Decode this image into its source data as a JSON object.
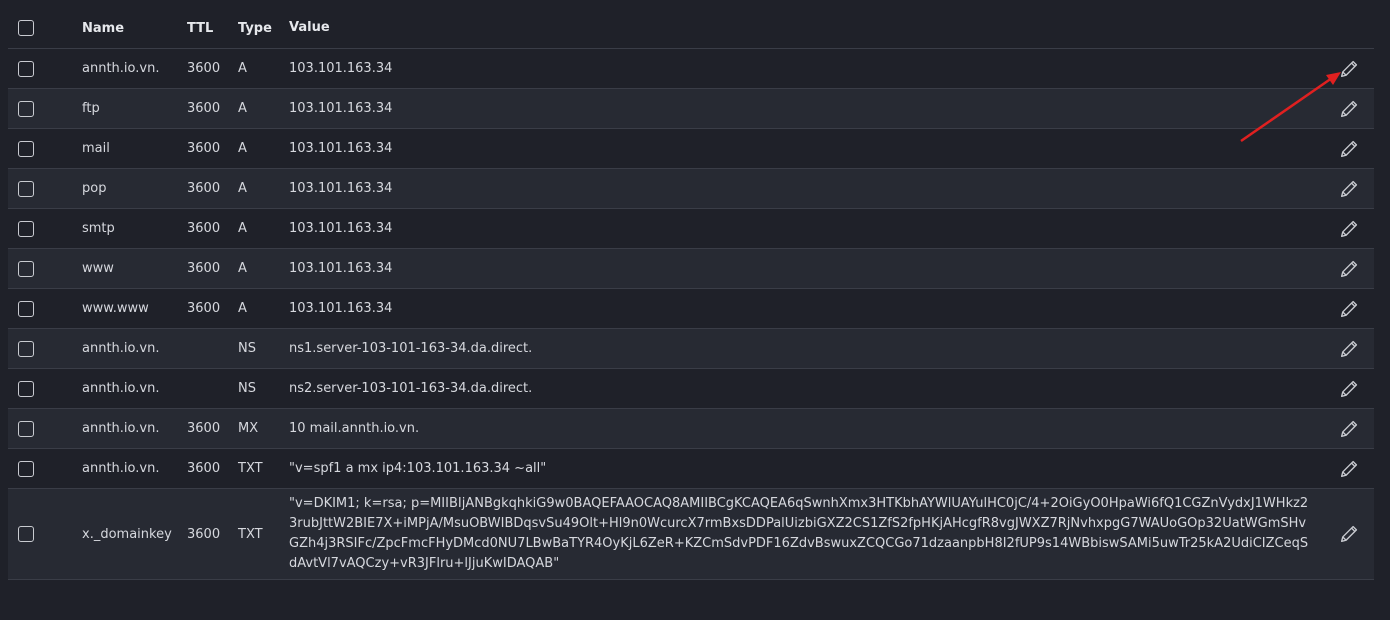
{
  "columns": {
    "name": "Name",
    "ttl": "TTL",
    "type": "Type",
    "value": "Value"
  },
  "records": [
    {
      "name": "annth.io.vn.",
      "ttl": "3600",
      "type": "A",
      "value": "103.101.163.34"
    },
    {
      "name": "ftp",
      "ttl": "3600",
      "type": "A",
      "value": "103.101.163.34"
    },
    {
      "name": "mail",
      "ttl": "3600",
      "type": "A",
      "value": "103.101.163.34"
    },
    {
      "name": "pop",
      "ttl": "3600",
      "type": "A",
      "value": "103.101.163.34"
    },
    {
      "name": "smtp",
      "ttl": "3600",
      "type": "A",
      "value": "103.101.163.34"
    },
    {
      "name": "www",
      "ttl": "3600",
      "type": "A",
      "value": "103.101.163.34"
    },
    {
      "name": "www.www",
      "ttl": "3600",
      "type": "A",
      "value": "103.101.163.34"
    },
    {
      "name": "annth.io.vn.",
      "ttl": "",
      "type": "NS",
      "value": "ns1.server-103-101-163-34.da.direct."
    },
    {
      "name": "annth.io.vn.",
      "ttl": "",
      "type": "NS",
      "value": "ns2.server-103-101-163-34.da.direct."
    },
    {
      "name": "annth.io.vn.",
      "ttl": "3600",
      "type": "MX",
      "value": "10 mail.annth.io.vn."
    },
    {
      "name": "annth.io.vn.",
      "ttl": "3600",
      "type": "TXT",
      "value": "\"v=spf1 a mx ip4:103.101.163.34 ~all\""
    },
    {
      "name": "x._domainkey",
      "ttl": "3600",
      "type": "TXT",
      "value": "\"v=DKIM1; k=rsa; p=MIIBIjANBgkqhkiG9w0BAQEFAAOCAQ8AMIIBCgKCAQEA6qSwnhXmx3HTKbhAYWlUAYulHC0jC/4+2OiGyO0HpaWi6fQ1CGZnVydxJ1WHkz23rubJttW2BIE7X+iMPjA/MsuOBWIBDqsvSu49Olt+Hl9n0WcurcX7rmBxsDDPalUizbiGXZ2CS1ZfS2fpHKjAHcgfR8vgJWXZ7RjNvhxpgG7WAUoGOp32UatWGmSHvGZh4j3RSIFc/ZpcFmcFHyDMcd0NU7LBwBaTYR4OyKjL6ZeR+KZCmSdvPDF16ZdvBswuxZCQCGo71dzaanpbH8I2fUP9s14WBbiswSAMi5uwTr25kA2UdiCIZCeqSdAvtVl7vAQCzy+vR3JFlru+lJjuKwIDAQAB\""
    }
  ],
  "icons": {
    "edit": "pencil-icon",
    "checkbox": "checkbox"
  },
  "colors": {
    "background": "#1f2129",
    "stripe": "#272a33",
    "annotation_arrow": "#e02020"
  }
}
